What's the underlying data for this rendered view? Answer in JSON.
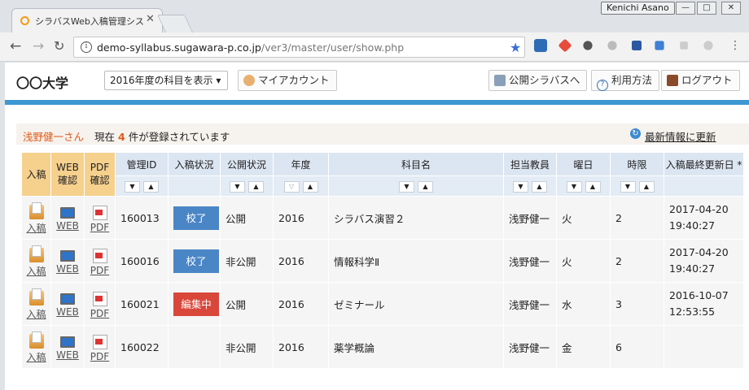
{
  "browser": {
    "tab_title": "シラバスWeb入稿管理シス",
    "user_name": "Kenichi Asano",
    "url_host": "demo-syllabus.sugawara-p.co.jp",
    "url_path": "/ver3/master/user/show.php"
  },
  "header": {
    "brand": "〇〇大学",
    "year_select": "2016年度の科目を表示",
    "my_account": "マイアカウント",
    "public_syllabus": "公開シラバスへ",
    "how_to": "利用方法",
    "logout": "ログアウト"
  },
  "status": {
    "user": "浅野健一さん",
    "prefix": "現在",
    "count": "4",
    "suffix": "件が登録されています",
    "refresh": "最新情報に更新"
  },
  "table": {
    "columns": {
      "entry": "入稿",
      "web": "WEB",
      "web_sub": "確認",
      "pdf": "PDF",
      "pdf_sub": "確認",
      "id": "管理ID",
      "entry_status": "入稿状況",
      "public_status": "公開状況",
      "year": "年度",
      "subject": "科目名",
      "teacher": "担当教員",
      "day": "曜日",
      "period": "時限",
      "updated": "入稿最終更新日 *"
    },
    "link_labels": {
      "entry": "入稿",
      "web": "WEB",
      "pdf": "PDF"
    },
    "rows": [
      {
        "id": "160013",
        "entry_status": "校了",
        "entry_color": "blue",
        "public": "公開",
        "year": "2016",
        "subject": "シラバス演習２",
        "teacher": "浅野健一",
        "day": "火",
        "period": "2",
        "date": "2017-04-20",
        "time": "19:40:27"
      },
      {
        "id": "160016",
        "entry_status": "校了",
        "entry_color": "blue",
        "public": "非公開",
        "year": "2016",
        "subject": "情報科学Ⅱ",
        "teacher": "浅野健一",
        "day": "火",
        "period": "2",
        "date": "2017-04-20",
        "time": "19:40:27"
      },
      {
        "id": "160021",
        "entry_status": "編集中",
        "entry_color": "red",
        "public": "公開",
        "year": "2016",
        "subject": "ゼミナール",
        "teacher": "浅野健一",
        "day": "水",
        "period": "3",
        "date": "2016-10-07",
        "time": "12:53:55"
      },
      {
        "id": "160022",
        "entry_status": "",
        "entry_color": "",
        "public": "非公開",
        "year": "2016",
        "subject": "薬学概論",
        "teacher": "浅野健一",
        "day": "金",
        "period": "6",
        "date": "",
        "time": ""
      }
    ]
  },
  "colors": {
    "accent": "#3d97d3",
    "orange_header": "#f6d08d",
    "badge_done": "#4a86c6",
    "badge_editing": "#d9473a"
  }
}
